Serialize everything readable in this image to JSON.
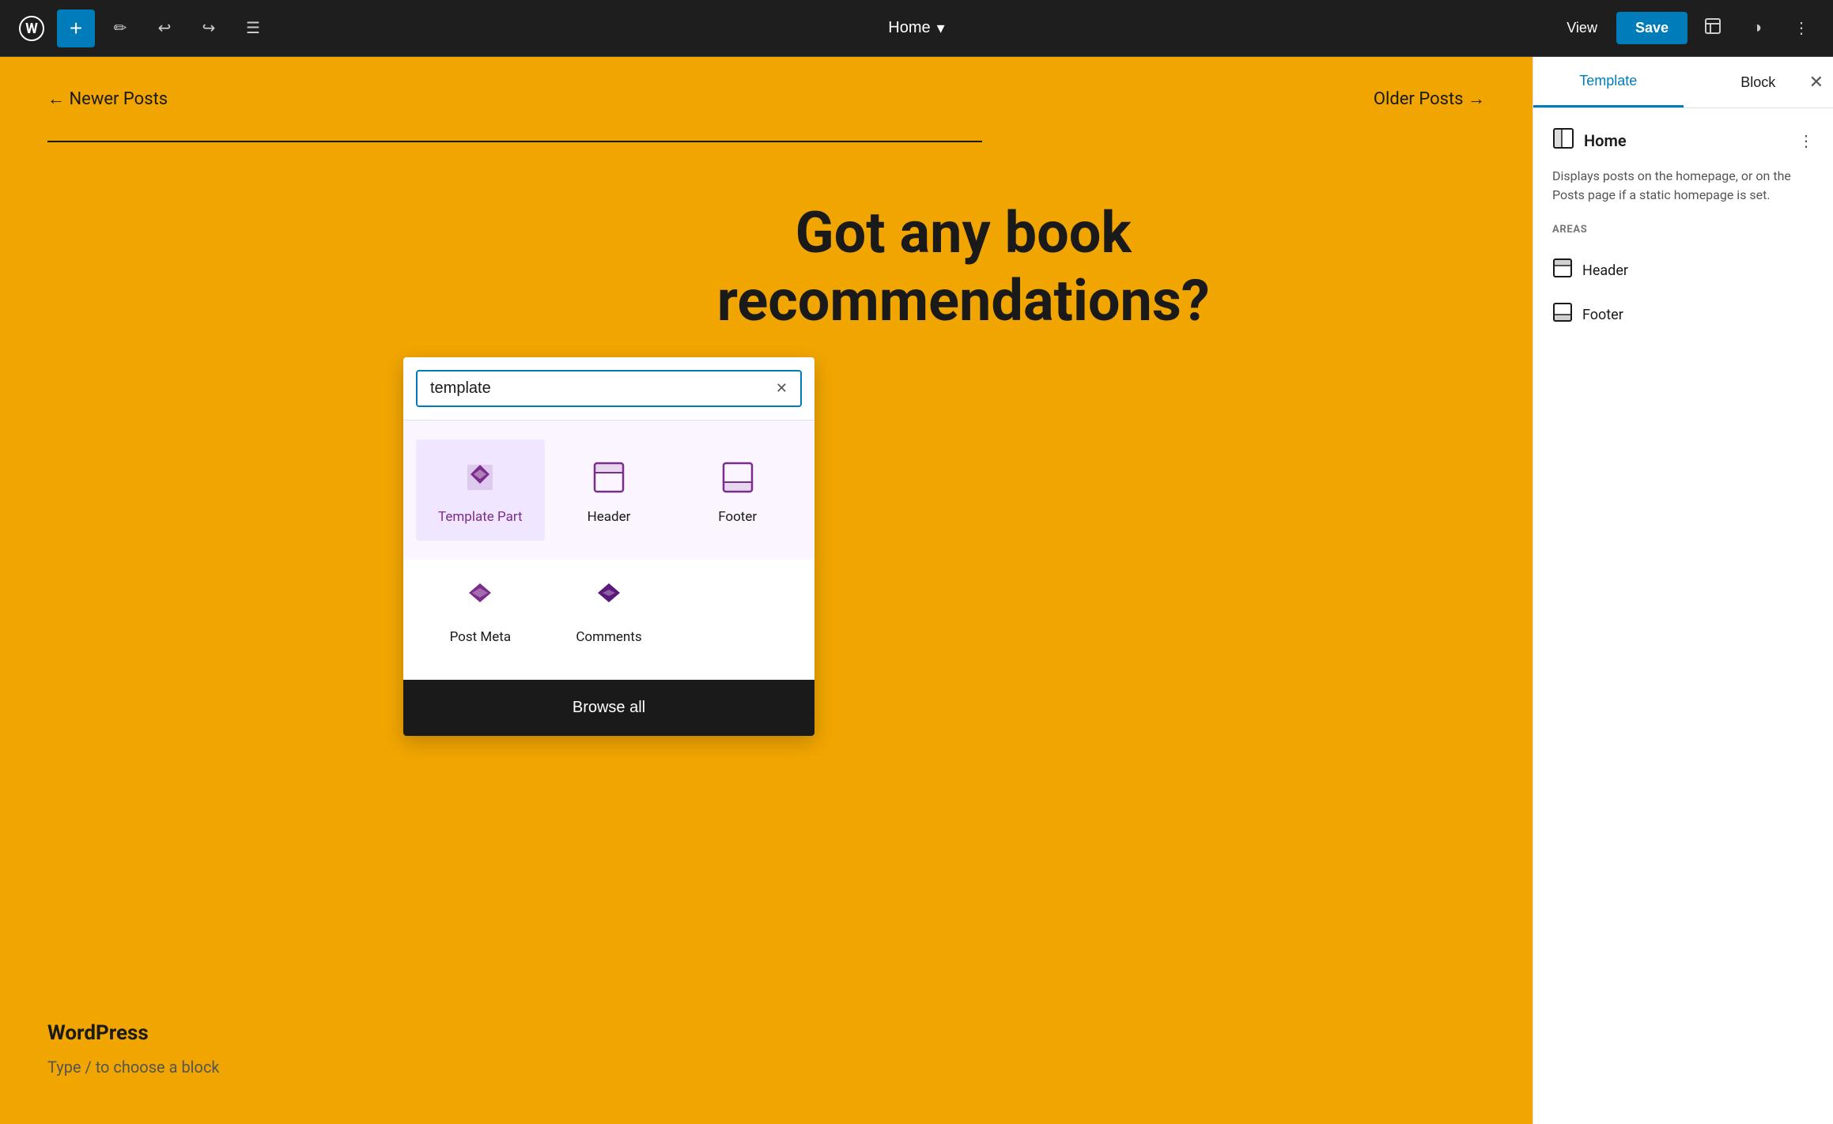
{
  "toolbar": {
    "add_label": "+",
    "page_title": "Home",
    "page_title_chevron": "▾",
    "view_label": "View",
    "save_label": "Save"
  },
  "canvas": {
    "nav_newer": "← Newer Posts",
    "nav_older": "Older Posts →",
    "hero_line1": "Got any book",
    "hero_line2": "recommendations?",
    "footer_brand": "WordPress",
    "type_hint": "Type / to choose a block"
  },
  "inserter": {
    "search_value": "template",
    "search_placeholder": "Search",
    "blocks": [
      {
        "id": "template-part",
        "label": "Template Part",
        "selected": true
      },
      {
        "id": "header",
        "label": "Header",
        "selected": false
      },
      {
        "id": "footer",
        "label": "Footer",
        "selected": false
      },
      {
        "id": "post-meta",
        "label": "Post Meta",
        "selected": false
      },
      {
        "id": "comments",
        "label": "Comments",
        "selected": false
      }
    ],
    "browse_all_label": "Browse all"
  },
  "sidebar": {
    "tab_template": "Template",
    "tab_block": "Block",
    "template_name": "Home",
    "template_description": "Displays posts on the homepage, or on the Posts page if a static homepage is set.",
    "areas_label": "AREAS",
    "areas": [
      {
        "label": "Header"
      },
      {
        "label": "Footer"
      }
    ]
  }
}
